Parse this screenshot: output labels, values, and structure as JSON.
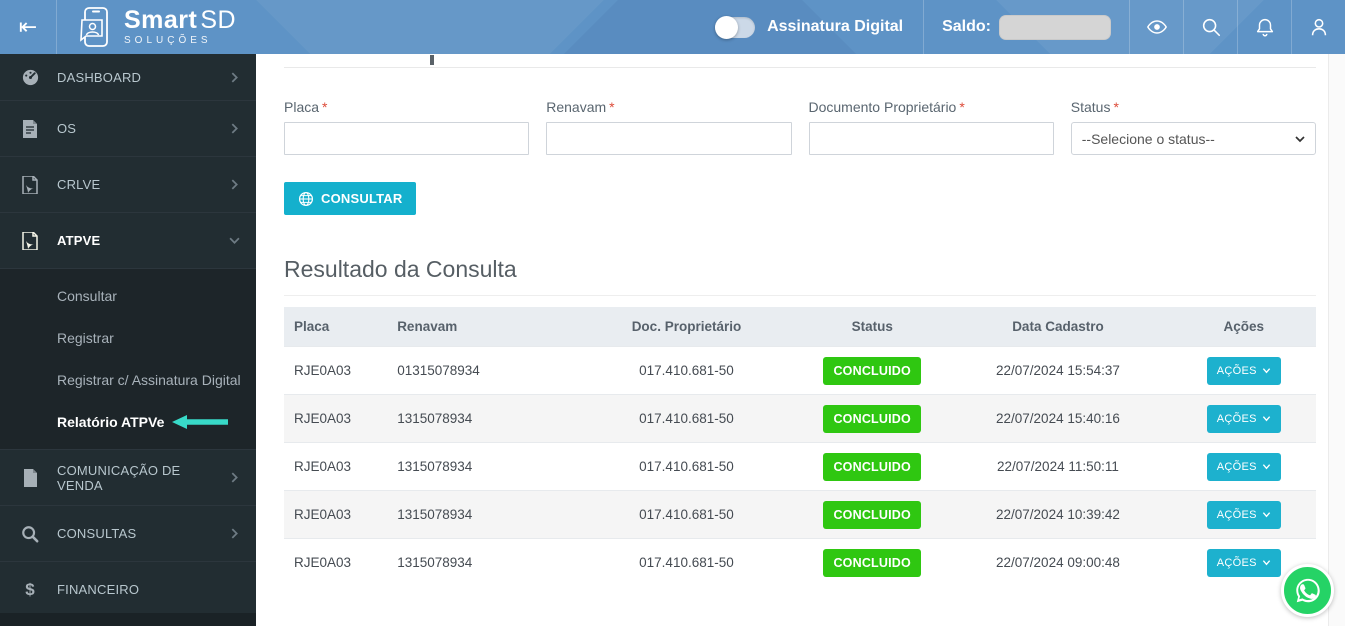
{
  "header": {
    "collapse_glyph": "⇤",
    "brand": {
      "name_bold": "Smart",
      "name_light": "SD",
      "subtitle": "SOLUÇÕES"
    },
    "assinatura_toggle_label": "Assinatura Digital",
    "saldo_label": "Saldo:"
  },
  "sidebar": {
    "items": [
      {
        "label": "DASHBOARD"
      },
      {
        "label": "OS"
      },
      {
        "label": "CRLVE"
      },
      {
        "label": "ATPVE"
      },
      {
        "label": "COMUNICAÇÃO DE VENDA"
      },
      {
        "label": "CONSULTAS"
      },
      {
        "label": "FINANCEIRO"
      }
    ],
    "dollar_glyph": "$",
    "atpve_submenu": [
      {
        "label": "Consultar"
      },
      {
        "label": "Registrar"
      },
      {
        "label": "Registrar c/ Assinatura Digital"
      },
      {
        "label": "Relatório ATPVe"
      }
    ]
  },
  "form": {
    "placa_label": "Placa",
    "renavam_label": "Renavam",
    "doc_label": "Documento Proprietário",
    "status_label": "Status",
    "required_marker": "*",
    "placa_value": "",
    "renavam_value": "",
    "doc_value": "",
    "status_selected_option": "--Selecione o status--",
    "consultar_button": "CONSULTAR"
  },
  "results": {
    "title": "Resultado da Consulta",
    "columns": [
      "Placa",
      "Renavam",
      "Doc. Proprietário",
      "Status",
      "Data Cadastro",
      "Ações"
    ],
    "actions_button_label": "AÇÕES",
    "rows": [
      {
        "placa": "RJE0A03",
        "renavam": "01315078934",
        "doc_proprietario": "017.410.681-50",
        "status": "CONCLUIDO",
        "data_cadastro": "22/07/2024 15:54:37"
      },
      {
        "placa": "RJE0A03",
        "renavam": "1315078934",
        "doc_proprietario": "017.410.681-50",
        "status": "CONCLUIDO",
        "data_cadastro": "22/07/2024 15:40:16"
      },
      {
        "placa": "RJE0A03",
        "renavam": "1315078934",
        "doc_proprietario": "017.410.681-50",
        "status": "CONCLUIDO",
        "data_cadastro": "22/07/2024 11:50:11"
      },
      {
        "placa": "RJE0A03",
        "renavam": "1315078934",
        "doc_proprietario": "017.410.681-50",
        "status": "CONCLUIDO",
        "data_cadastro": "22/07/2024 10:39:42"
      },
      {
        "placa": "RJE0A03",
        "renavam": "1315078934",
        "doc_proprietario": "017.410.681-50",
        "status": "CONCLUIDO",
        "data_cadastro": "22/07/2024 09:00:48"
      }
    ]
  },
  "colors": {
    "header_blue": "#5e93c6",
    "sidebar_dark": "#222d32",
    "accent_cyan": "#14b0cd",
    "status_green": "#2fc711",
    "whatsapp_green": "#25d366",
    "annotation_arrow_cyan": "#38dac8",
    "required_red": "#dd4b39"
  }
}
